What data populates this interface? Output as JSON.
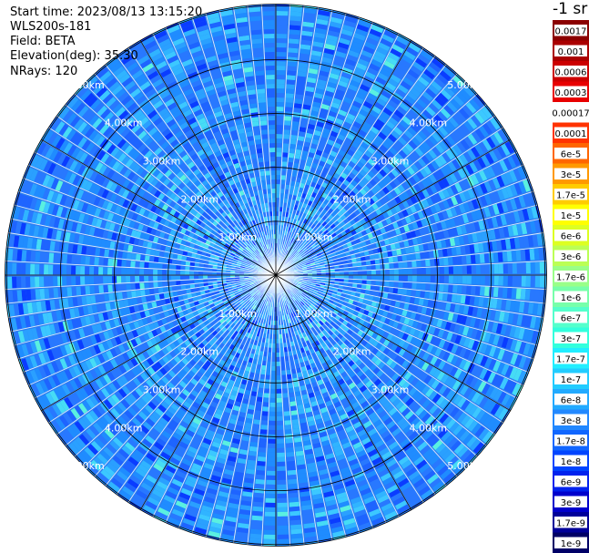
{
  "header": {
    "start_time": "Start time: 2023/08/13 13:15:20",
    "instrument": "WLS200s-181",
    "field": "Field: BETA",
    "elevation": "Elevation(deg): 35.30",
    "nrays": "NRays: 120"
  },
  "colorbar": {
    "title": "-1 sr",
    "labels": [
      "0.0017",
      "0.001",
      "0.0006",
      "0.0003",
      "0.00017",
      "0.0001",
      "6e-5",
      "3e-5",
      "1.7e-5",
      "1e-5",
      "6e-6",
      "3e-6",
      "1.7e-6",
      "1e-6",
      "6e-7",
      "3e-7",
      "1.7e-7",
      "1e-7",
      "6e-8",
      "3e-8",
      "1.7e-8",
      "1e-8",
      "6e-9",
      "3e-9",
      "1.7e-9",
      "1e-9"
    ],
    "colors": [
      "#8b0000",
      "#aa0000",
      "#cc0000",
      "#e80000",
      "#ffffff",
      "#ff3300",
      "#ff6600",
      "#ff9900",
      "#ffcc00",
      "#ffff00",
      "#ddff22",
      "#bbff55",
      "#99ff88",
      "#77ffaa",
      "#55ffcc",
      "#33ffdd",
      "#22eeff",
      "#22ccff",
      "#22aaff",
      "#2288ff",
      "#1166ff",
      "#0044ff",
      "#0022ee",
      "#0000cc",
      "#000099",
      "#000066"
    ]
  },
  "chart_data": {
    "type": "ppi",
    "field": "BETA",
    "elevation_deg": 35.3,
    "n_rays": 120,
    "range_rings_km": [
      1.0,
      2.0,
      3.0,
      4.0,
      5.0
    ],
    "ring_labels": [
      "1.00km",
      "2.00km",
      "3.00km",
      "4.00km",
      "5.00km"
    ],
    "max_range_km": 5.95,
    "dominant_value_range": [
      "1e-8",
      "1e-7"
    ]
  }
}
